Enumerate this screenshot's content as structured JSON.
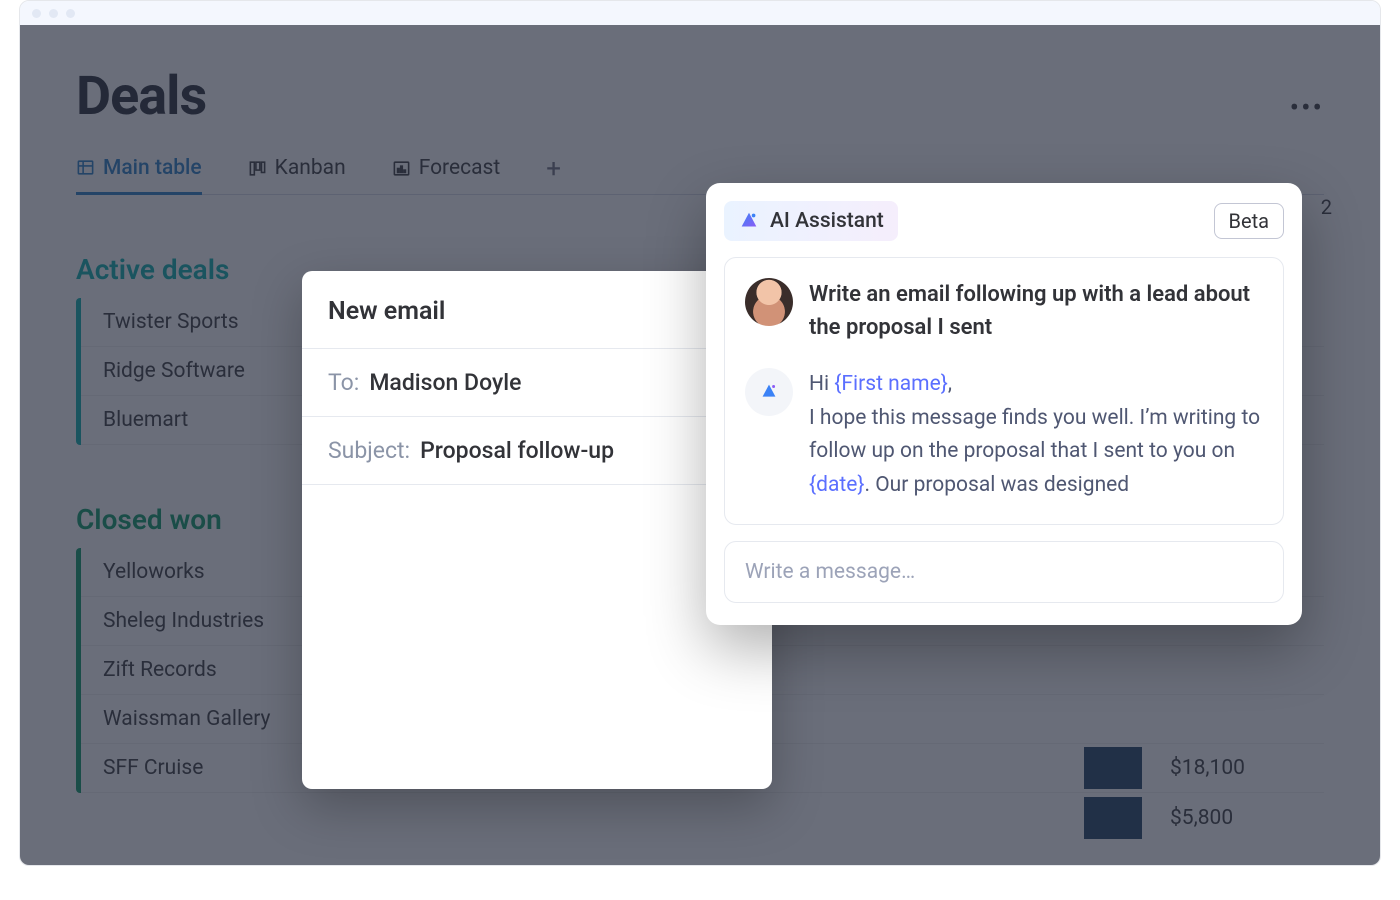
{
  "page": {
    "title": "Deals"
  },
  "tabs": {
    "main_table": "Main table",
    "kanban": "Kanban",
    "forecast": "Forecast"
  },
  "hidden_col_hint": "2",
  "groups": {
    "active": {
      "title": "Active deals",
      "rows": [
        "Twister Sports",
        "Ridge Software",
        "Bluemart"
      ]
    },
    "closed": {
      "title": "Closed won",
      "rows": [
        "Yelloworks",
        "Sheleg Industries",
        "Zift Records",
        "Waissman Gallery",
        "SFF Cruise"
      ]
    }
  },
  "right_values": [
    {
      "price": "$18,100"
    },
    {
      "price": "$5,800"
    }
  ],
  "email": {
    "title": "New email",
    "to_label": "To:",
    "to_value": "Madison Doyle",
    "subject_label": "Subject:",
    "subject_value": "Proposal follow-up"
  },
  "assistant": {
    "brand": "AI Assistant",
    "beta": "Beta",
    "user_prompt": "Write an email following up with a lead about the proposal I sent",
    "ai_reply": {
      "pre": "Hi ",
      "token1": "{First name}",
      "mid1": ",",
      "line2": "I hope this message finds you well. I’m writing to follow up on the proposal that I sent to you on ",
      "token2": "{date}",
      "tail": ". Our proposal was designed"
    },
    "compose_placeholder": "Write a message…"
  }
}
